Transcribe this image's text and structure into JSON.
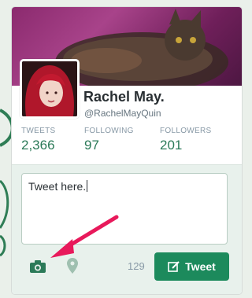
{
  "profile": {
    "name": "Rachel May.",
    "handle": "@RachelMayQuin"
  },
  "stats": [
    {
      "label": "TWEETS",
      "value": "2,366"
    },
    {
      "label": "FOLLOWING",
      "value": "97"
    },
    {
      "label": "FOLLOWERS",
      "value": "201"
    }
  ],
  "compose": {
    "text": "Tweet here.",
    "char_count": "129",
    "tweet_label": "Tweet"
  },
  "colors": {
    "accent": "#1c8a5c",
    "arrow": "#e8195b"
  }
}
